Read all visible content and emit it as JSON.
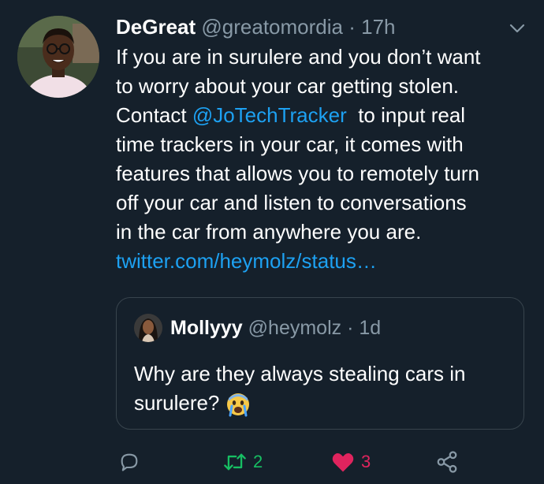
{
  "tweet": {
    "author_name": "DeGreat",
    "handle": "@greatomordia",
    "separator": "·",
    "time": "17h",
    "text_lines": [
      "If you are in surulere and you don’t want",
      "to worry about your car getting stolen."
    ],
    "line3_prefix": "Contact ",
    "mention": "@JoTechTracker",
    "line3_suffix": "  to input real",
    "text_lines_b": [
      "time trackers in your car, it comes with",
      "features that allows you to remotely turn",
      "off your car and listen to conversations",
      "in the car from anywhere you are."
    ],
    "link": "twitter.com/heymolz/status…"
  },
  "quote": {
    "author_name": "Mollyyy",
    "handle": "@heymolz",
    "separator": "·",
    "time": "1d",
    "text_line1": "Why are they always stealing cars in",
    "text_line2": "surulere? "
  },
  "actions": {
    "retweet_count": "2",
    "like_count": "3"
  },
  "colors": {
    "background": "#15202b",
    "link": "#1da1f2",
    "retweet": "#17bf63",
    "like": "#e0245e",
    "muted": "#8899a6"
  },
  "icons": [
    "chevron-down-icon",
    "reply-icon",
    "retweet-icon",
    "heart-icon",
    "share-icon",
    "crying-face-emoji"
  ]
}
